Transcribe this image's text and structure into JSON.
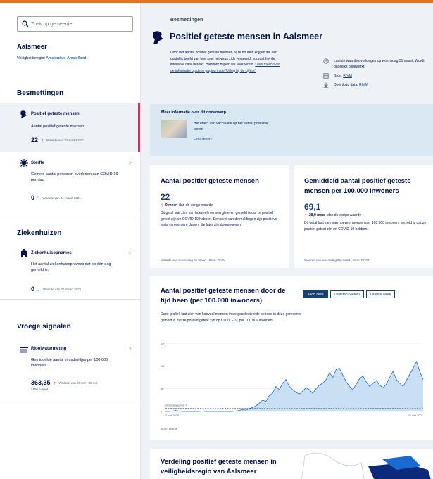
{
  "search": {
    "placeholder": "Zoek op gemeente"
  },
  "sidebar": {
    "municipality": "Aalsmeer",
    "region_label": "Veiligheidsregio:",
    "region_link": "Amsterdam-Amstelland",
    "sections": {
      "infections": "Besmettingen",
      "hospitals": "Ziekenhuizen",
      "early": "Vroege signalen"
    },
    "items": [
      {
        "title": "Positief geteste mensen",
        "desc": "Aantal positief geteste mensen",
        "value": "22",
        "note": "Waarde van 31 maart 2021",
        "trend": "up"
      },
      {
        "title": "Sterfte",
        "desc": "Gemeld aantal personen overleden aan COVID-19 per dag",
        "value": "0",
        "note": "Waarde van 31 maart 2021",
        "trend": "none"
      },
      {
        "title": "Ziekenhuisopnames",
        "desc": "Het aantal ziekenhuisopnames dat op één dag gemeld is.",
        "value": "0",
        "note": "Waarde van 30 maart 2021",
        "trend": "down"
      },
      {
        "title": "Rioolwatermeting",
        "desc": "Gemiddelde aantal virusdeeltjes per 100.000 inwoners",
        "value": "363,35",
        "note": "Waarde van 22 mrt - 28 mrt",
        "unit": "x100 miljard",
        "trend": "up"
      }
    ]
  },
  "header": {
    "kicker": "Besmettingen",
    "title": "Positief geteste mensen in Aalsmeer",
    "intro": "Door het aantal positief geteste mensen bij te houden krijgen we een duidelijk beeld van hoe snel het virus zich verspreidt voordat het de intensive care bereikt. Hierdoor blijven we voorbereid.",
    "intro_link": "Lees meer over de informatie op deze pagina in de 'Uitleg bij de cijfers'.",
    "meta": {
      "updated": "Laatste waardes verkregen op woensdag 31 maart. Wordt dagelijks bijgewerkt.",
      "source_label": "Bron:",
      "source": "RIVM",
      "download_label": "Download data:",
      "download": "RIVM"
    }
  },
  "info": {
    "title": "Meer informatie over dit onderwerp",
    "text": "Het effect van vaccinatie op het aantal positieve testen",
    "link": "Lees meer"
  },
  "cards": {
    "total": {
      "title": "Aantal positief geteste mensen",
      "value": "22",
      "delta": "9 meer",
      "delta_suffix": "dan de vorige waarde",
      "desc": "Dit getal laat zien van hoeveel mensen gisteren gemeld is dat ze positief getest zijn en COVID-19 hebben. Een deel van de meldingen zijn positieve tests van eerdere dagen, die later zijn doorgegeven.",
      "foot": "Waarde van woensdag 31 maart · Bron: RIVM"
    },
    "per100k": {
      "title": "Gemiddeld aantal positief geteste mensen per 100.000 inwoners",
      "value": "69,1",
      "delta": "28,9 meer",
      "delta_suffix": "dan de vorige waarde",
      "desc": "Dit getal laat zien van hoeveel mensen per 100.000 inwoners gemeld is dat ze positief getest zijn en COVID-19 hebben.",
      "foot": "Waarde van woensdag 31 maart · Bron: RIVM"
    },
    "chart": {
      "title": "Aantal positief geteste mensen door de tijd heen (per 100.000 inwoners)",
      "desc": "Deze grafiek laat zien van hoeveel mensen in de geselecteerde periode in deze gemeente gemeld is dat ze positief getest zijn op COVID-19, per 100.000 inwoners.",
      "tabs": [
        "Toon alles",
        "Laatste 5 weken",
        "Laatste week"
      ],
      "signal_label": "Signaalwaarde: 7",
      "foot": "Bron: RIVM"
    },
    "region": {
      "title": "Verdeling positief geteste mensen in veiligheidsregio van Aalsmeer"
    }
  },
  "chart_data": {
    "type": "area",
    "x_start": "2 mrt 2020",
    "x_end": "31 mrt 2021",
    "yticks": [
      0,
      50,
      100,
      150
    ],
    "ylim": [
      0,
      150
    ],
    "signal_value": 7,
    "series": [
      {
        "values": [
          0,
          0,
          1,
          2,
          1,
          0,
          0,
          0,
          0,
          0,
          0,
          1,
          0,
          0,
          0,
          0,
          0,
          0,
          0,
          0,
          0,
          1,
          2,
          4,
          3,
          6,
          9,
          12,
          18,
          25,
          22,
          35,
          40,
          55,
          48,
          62,
          70,
          55,
          48,
          42,
          38,
          45,
          52,
          48,
          40,
          50,
          58,
          62,
          70,
          85,
          75,
          92,
          95,
          80,
          65,
          55,
          48,
          60,
          72,
          78,
          65,
          55,
          62,
          68,
          58,
          52,
          60,
          75,
          88,
          70,
          62,
          55,
          68,
          82,
          95,
          110,
          88,
          70
        ]
      }
    ],
    "colors": {
      "line": "#1a6bd1",
      "fill": "#c9dff3",
      "signal": "#555e70"
    }
  }
}
